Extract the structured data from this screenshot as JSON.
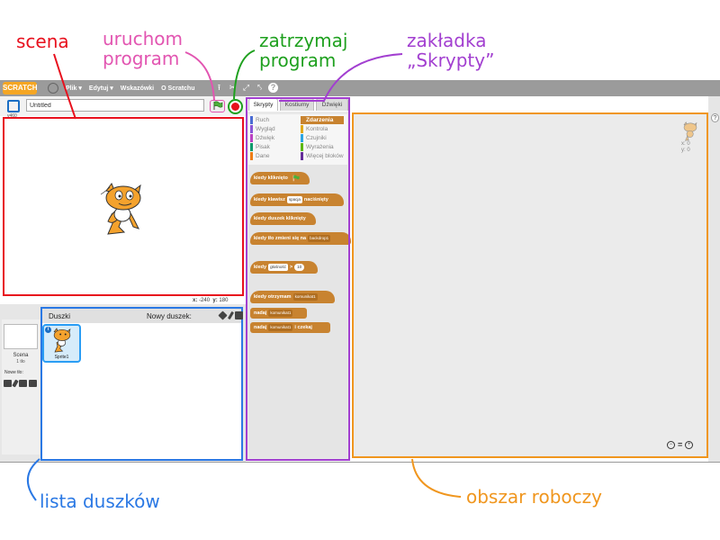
{
  "annotations": {
    "stage": "scena",
    "run_line1": "uruchom",
    "run_line2": "program",
    "stop_line1": "zatrzymaj",
    "stop_line2": "program",
    "tab_line1": "zakładka",
    "tab_line2": "„Skrypty”",
    "sprite_list": "lista duszków",
    "workspace": "obszar roboczy"
  },
  "colors": {
    "stage": "#e8101d",
    "run": "#e255b1",
    "stop": "#1ea01e",
    "scripts_tab": "#a23fd0",
    "sprite_list": "#2a78e4",
    "workspace": "#f0961e"
  },
  "menubar": {
    "logo": "SCRATCH",
    "items": [
      "Plik ▾",
      "Edytuj ▾",
      "Wskazówki",
      "O Scratchu"
    ],
    "icons": [
      "globe-icon",
      "duplicate-icon",
      "cut-icon",
      "grow-icon",
      "shrink-icon",
      "help-icon"
    ]
  },
  "stage_header": {
    "version": "v460",
    "project_title": "Untitled"
  },
  "stage_info": {
    "x_label": "x:",
    "x_value": "-240",
    "y_label": "y:",
    "y_value": "180"
  },
  "scene_panel": {
    "label": "Scena",
    "sub": "1 tło",
    "new_backdrop": "Nowe tło:"
  },
  "sprites": {
    "title": "Duszki",
    "new_sprite": "Nowy duszek:",
    "items": [
      {
        "name": "Sprite1"
      }
    ]
  },
  "tabs": [
    "Skrypty",
    "Kostiumy",
    "Dźwięki"
  ],
  "categories": {
    "left": [
      {
        "label": "Ruch",
        "color": "#4a6cd4"
      },
      {
        "label": "Wygląd",
        "color": "#8a55d7"
      },
      {
        "label": "Dźwięk",
        "color": "#bb42c3"
      },
      {
        "label": "Pisak",
        "color": "#0e9a6c"
      },
      {
        "label": "Dane",
        "color": "#ee7d16"
      }
    ],
    "right": [
      {
        "label": "Zdarzenia",
        "color": "#c88330"
      },
      {
        "label": "Kontrola",
        "color": "#e1a91a"
      },
      {
        "label": "Czujniki",
        "color": "#2ca5e2"
      },
      {
        "label": "Wyrażenia",
        "color": "#5cb712"
      },
      {
        "label": "Więcej bloków",
        "color": "#632d99"
      }
    ]
  },
  "blocks": {
    "when_flag": "kiedy kliknięto",
    "when_key_pre": "kiedy klawisz",
    "when_key_slot": "spacja",
    "when_key_post": "naciśnięty",
    "when_sprite": "kiedy duszek kliknięty",
    "when_backdrop_pre": "kiedy tło zmieni się na",
    "when_backdrop_slot": "backdrop1",
    "when_loudness_pre": "kiedy",
    "when_loudness_slot": "głośność",
    "when_loudness_op": ">",
    "when_loudness_val": "10",
    "when_receive_pre": "kiedy otrzymam",
    "when_receive_slot": "komunikat1",
    "broadcast_pre": "nadaj",
    "broadcast_slot": "komunikat1",
    "broadcast_wait_pre": "nadaj",
    "broadcast_wait_slot": "komunikat1",
    "broadcast_wait_post": "i czekaj"
  },
  "script_area": {
    "x_label": "x: 0",
    "y_label": "y: 0"
  }
}
